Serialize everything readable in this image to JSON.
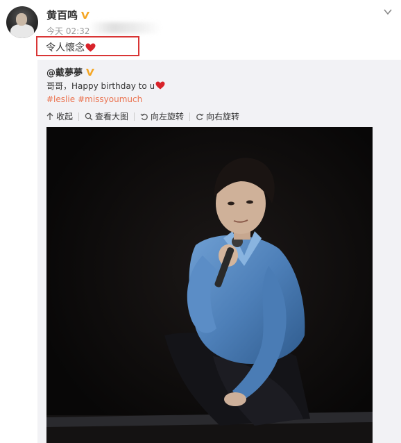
{
  "post": {
    "user_name": "黄百鸣",
    "timestamp": "今天 02:32",
    "text": "令人懷念",
    "heart_icon": "heart-icon",
    "verified_icon": "verified-v-icon"
  },
  "repost": {
    "user_name": "@戴夢夢",
    "text": "哥哥，Happy birthday to u",
    "tags": [
      "#leslie",
      "#missyoumuch"
    ],
    "actions": {
      "collapse": "收起",
      "view_large": "查看大图",
      "rotate_left": "向左旋转",
      "rotate_right": "向右旋转"
    }
  },
  "colors": {
    "highlight_box": "#d93535",
    "tag": "#eb7350",
    "verified": "#f5a623",
    "heart": "#d8232a"
  }
}
